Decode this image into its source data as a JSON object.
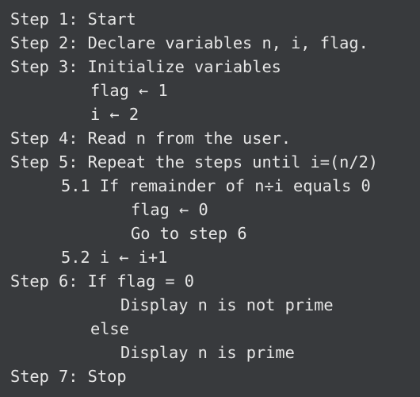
{
  "algorithm": {
    "lines": [
      "Step 1: Start",
      "Step 2: Declare variables n, i, flag.",
      "Step 3: Initialize variables",
      "flag ← 1",
      "i ← 2",
      "Step 4: Read n from the user.",
      "Step 5: Repeat the steps until i=(n/2)",
      "5.1 If remainder of n÷i equals 0",
      "flag ← 0",
      "Go to step 6",
      "5.2 i ← i+1",
      "Step 6: If flag = 0",
      "Display n is not prime",
      "else",
      "Display n is prime",
      "Step 7: Stop"
    ]
  },
  "colors": {
    "background": "#383a3d",
    "text": "#e6e6e6"
  }
}
